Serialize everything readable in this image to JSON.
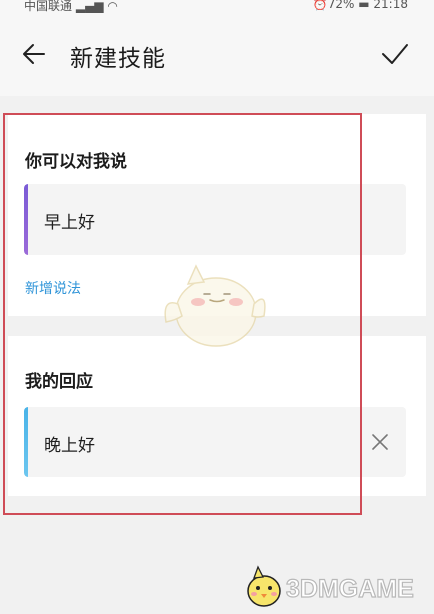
{
  "statusbar": {
    "carrier": "中国联通",
    "signal_icon": "signal-wifi-icon",
    "right": "⏰72% ▬ 21:18"
  },
  "header": {
    "back_icon": "arrow-left-icon",
    "title": "新建技能",
    "confirm_icon": "checkmark-icon"
  },
  "say_section": {
    "title": "你可以对我说",
    "phrases": [
      "早上好"
    ],
    "add_label": "新增说法"
  },
  "reply_section": {
    "title": "我的回应",
    "phrases": [
      "晚上好"
    ],
    "clear_icon": "close-icon"
  },
  "watermark": {
    "text": "3DMGAME"
  },
  "colors": {
    "highlight_border": "#cf4c57",
    "link": "#2f94d8",
    "bar_purple": "#8a63d8",
    "bar_blue": "#55bbea"
  }
}
